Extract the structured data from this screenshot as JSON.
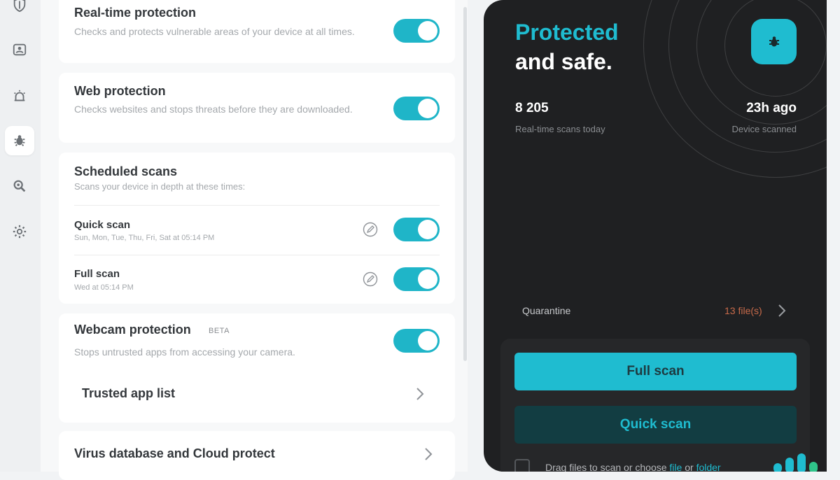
{
  "colors": {
    "accent": "#1fb5c8",
    "panel_bg": "#1f2022",
    "quarantine": "#c76a4a"
  },
  "sidebar": {
    "items": [
      {
        "icon": "shield-icon"
      },
      {
        "icon": "id-card-icon"
      },
      {
        "icon": "alarm-icon"
      },
      {
        "icon": "bug-icon",
        "active": true
      },
      {
        "icon": "magnify-icon"
      },
      {
        "icon": "gear-icon"
      }
    ]
  },
  "settings": {
    "realtime": {
      "title": "Real-time protection",
      "desc": "Checks and protects vulnerable areas of your device at all times.",
      "enabled": true
    },
    "web": {
      "title": "Web protection",
      "desc": "Checks websites and stops threats before they are downloaded.",
      "enabled": true
    },
    "scheduled": {
      "title": "Scheduled scans",
      "desc": "Scans your device in depth at these times:",
      "items": [
        {
          "title": "Quick scan",
          "schedule": "Sun, Mon, Tue, Thu, Fri, Sat at 05:14 PM",
          "enabled": true
        },
        {
          "title": "Full scan",
          "schedule": "Wed at 05:14 PM",
          "enabled": true
        }
      ]
    },
    "webcam": {
      "title": "Webcam protection",
      "badge": "BETA",
      "desc": "Stops untrusted apps from accessing your camera.",
      "enabled": true,
      "trusted_label": "Trusted app list"
    },
    "virusdb": {
      "title": "Virus database and Cloud protect"
    }
  },
  "panel": {
    "title_accent": "Protected",
    "title_rest": "and safe.",
    "scans_value": "8 205",
    "scans_label": "Real-time scans today",
    "last_value": "23h ago",
    "last_label": "Device scanned",
    "quarantine_label": "Quarantine",
    "quarantine_count": "13 file(s)",
    "full_scan": "Full scan",
    "quick_scan": "Quick scan",
    "drag_prefix": "Drag files to scan or choose",
    "drag_file": "file",
    "drag_or": "or",
    "drag_folder": "folder"
  }
}
